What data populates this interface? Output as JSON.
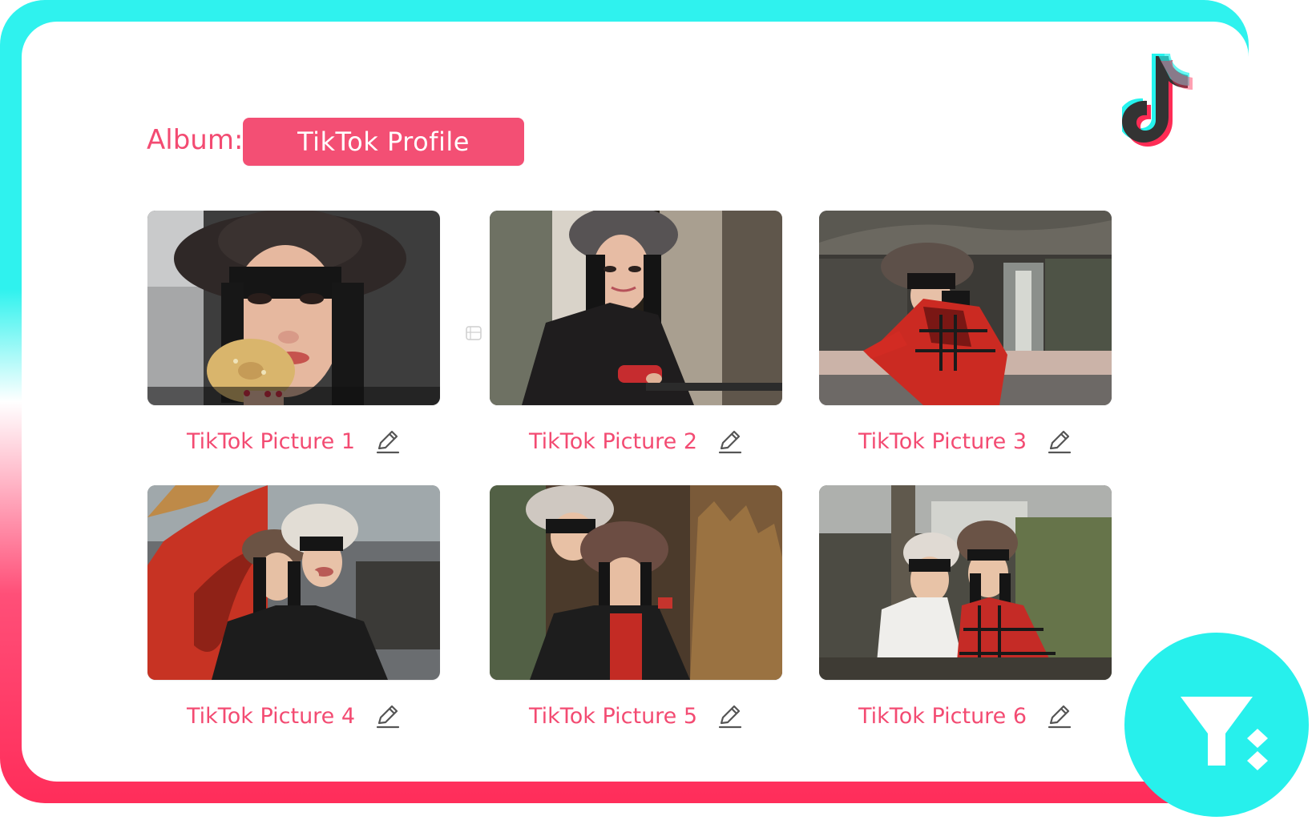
{
  "album": {
    "label": "Album:",
    "name": "TikTok Profile"
  },
  "brand": {
    "logo_icon": "tiktok-logo-icon",
    "badge_icon": "filter-sort-icon",
    "colors": {
      "accent": "#f34b72",
      "cyan": "#2ff2ee",
      "pink": "#ff2d5a",
      "badge": "#27f0ec"
    }
  },
  "gallery": {
    "items": [
      {
        "title": "TikTok Picture 1",
        "edit_icon": "edit-pencil-icon"
      },
      {
        "title": "TikTok Picture 2",
        "edit_icon": "edit-pencil-icon"
      },
      {
        "title": "TikTok Picture 3",
        "edit_icon": "edit-pencil-icon"
      },
      {
        "title": "TikTok Picture 4",
        "edit_icon": "edit-pencil-icon"
      },
      {
        "title": "TikTok Picture 5",
        "edit_icon": "edit-pencil-icon"
      },
      {
        "title": "TikTok Picture 6",
        "edit_icon": "edit-pencil-icon"
      }
    ]
  }
}
